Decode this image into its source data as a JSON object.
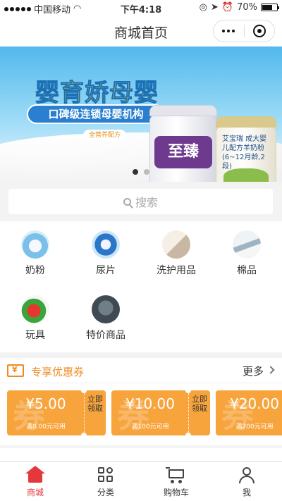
{
  "status_bar": {
    "carrier": "中国移动",
    "time": "下午4:18",
    "battery": "70%",
    "battery_level": 0.7
  },
  "nav": {
    "title": "商城首页"
  },
  "banner": {
    "headline": "婴育娇母婴",
    "subline": "口碑级连锁母婴机构",
    "tag": "全营养配方",
    "product1_brand": "至臻",
    "product2_text": "艾宝瑞 成大婴儿配方羊奶粉 (6~12月龄,2段)",
    "slides": 2,
    "active_slide": 1
  },
  "search": {
    "placeholder": "搜索"
  },
  "categories": [
    {
      "label": "奶粉",
      "icon": "milk-powder-icon"
    },
    {
      "label": "尿片",
      "icon": "diaper-icon"
    },
    {
      "label": "洗护用品",
      "icon": "wash-care-icon"
    },
    {
      "label": "棉品",
      "icon": "cotton-icon"
    },
    {
      "label": "玩具",
      "icon": "toy-icon"
    },
    {
      "label": "特价商品",
      "icon": "special-offer-icon"
    }
  ],
  "coupons": {
    "title": "专享优惠券",
    "more": "更多",
    "watermark": "券",
    "claim": "立即领取",
    "items": [
      {
        "amount": "¥5.00",
        "condition": "满0.00元可用"
      },
      {
        "amount": "¥10.00",
        "condition": "满100元可用"
      },
      {
        "amount": "¥20.00",
        "condition": "满200元可用"
      }
    ]
  },
  "tabbar": {
    "items": [
      {
        "label": "商城",
        "icon": "home-icon",
        "active": true
      },
      {
        "label": "分类",
        "icon": "category-grid-icon",
        "active": false
      },
      {
        "label": "购物车",
        "icon": "cart-icon",
        "active": false
      },
      {
        "label": "我",
        "icon": "user-icon",
        "active": false
      }
    ]
  },
  "colors": {
    "accent": "#e4393c",
    "coupon": "#f7a43d",
    "coupon_title": "#f08a20"
  }
}
